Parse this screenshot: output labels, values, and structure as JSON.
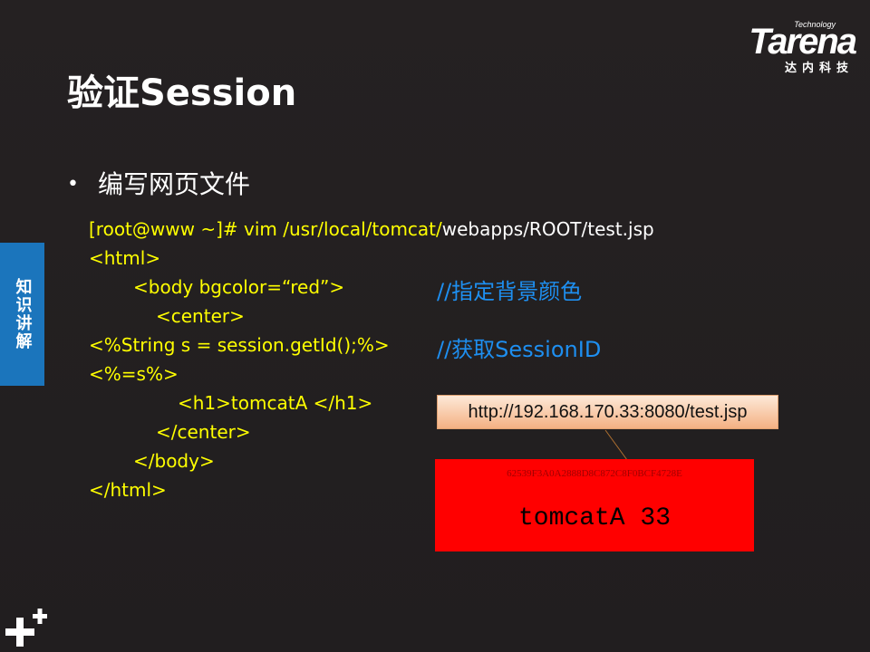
{
  "logo": {
    "tech": "Technology",
    "word": "Tarena",
    "cn": "达内科技"
  },
  "title": "验证Session",
  "bullet": "编写网页文件",
  "side_tab": "知识讲解",
  "code": {
    "line1_yellow": "[root@www ~]# vim /usr/local/tomcat/",
    "line1_white": "webapps/ROOT/test.jsp",
    "line2": "<html>",
    "line3": "<body bgcolor=“red”>",
    "line4": "<center>",
    "line5": "<%String s = session.getId();%>",
    "line6": "<%=s%>",
    "line7": "<h1>tomcatA </h1>",
    "line8": "</center>",
    "line9": "</body>",
    "line10": "</html>"
  },
  "comments": {
    "bgcolor": "//指定背景颜色",
    "session": "//获取SessionID"
  },
  "browser": {
    "url": "http://192.168.170.33:8080/test.jsp",
    "session_id": "62539F3A0A2888D8C872C8F0BCF4728E",
    "heading": "tomcatA 33"
  },
  "colors": {
    "background": "#231f20",
    "code_yellow": "#ffff00",
    "comment_blue": "#1e8ff0",
    "side_tab": "#1b75bc",
    "panel_red": "#ff0000"
  }
}
